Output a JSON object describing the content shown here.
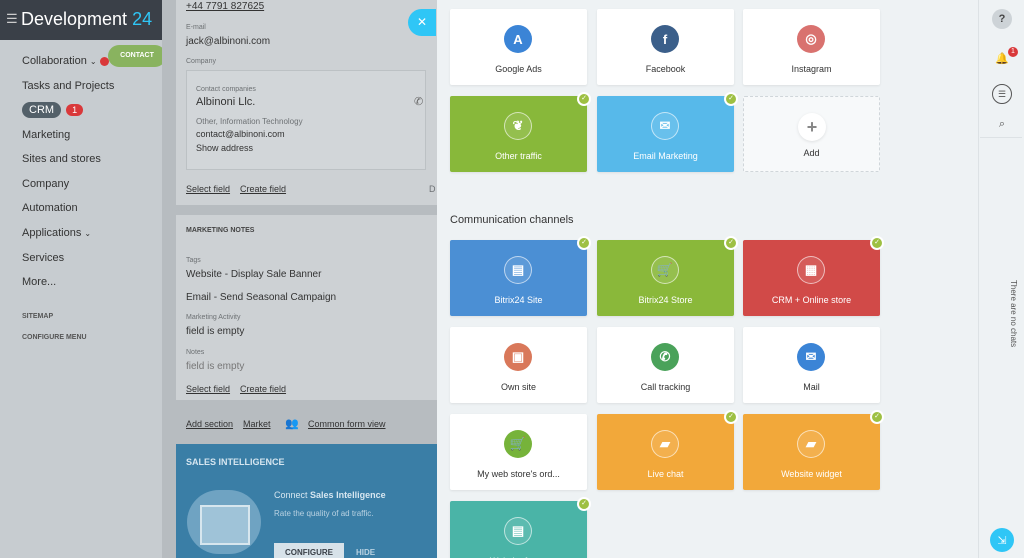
{
  "left_menu": {
    "title": "Development",
    "title_num": "24",
    "items": [
      "Collaboration",
      "Tasks and Projects",
      "CRM",
      "Marketing",
      "Sites and stores",
      "Company",
      "Automation",
      "Applications",
      "Services",
      "More..."
    ],
    "crm_badge": "1",
    "sitemap": "SITEMAP",
    "configure": "CONFIGURE MENU",
    "contact_button": "CONTACT"
  },
  "contact": {
    "phone": "+44 7791 827625",
    "email_label": "E-mail",
    "email": "jack@albinoni.com",
    "company_label": "Company",
    "contact_companies_label": "Contact companies",
    "company_name": "Albinoni Llc.",
    "company_info": "Other, Information Technology",
    "company_email": "contact@albinoni.com",
    "show_address": "Show address",
    "select_field": "Select field",
    "create_field": "Create field",
    "d": "D",
    "marketing_notes": "MARKETING NOTES",
    "tags_label": "Tags",
    "tag1": "Website - Display Sale Banner",
    "tag2": "Email - Send Seasonal Campaign",
    "activity_label": "Marketing Activity",
    "activity_value": "field is empty",
    "notes_label": "Notes",
    "notes_value": "field is empty",
    "add_section": "Add section",
    "market": "Market",
    "common_form": "Common form view"
  },
  "sales_intel": {
    "title": "SALES INTELLIGENCE",
    "connect": "Connect",
    "connect_bold": "Sales Intelligence",
    "rate": "Rate the quality of ad traffic.",
    "configure": "CONFIGURE",
    "hide": "HIDE"
  },
  "sources": [
    {
      "label": "Google Ads",
      "color": "#3b84d6",
      "icon": "google-ads-icon",
      "glyph": "A",
      "colored": false,
      "checked": false
    },
    {
      "label": "Facebook",
      "color": "#3b5f8a",
      "icon": "facebook-icon",
      "glyph": "f",
      "colored": false,
      "checked": false
    },
    {
      "label": "Instagram",
      "color": "#d9726f",
      "icon": "instagram-icon",
      "glyph": "◎",
      "colored": false,
      "checked": false
    },
    {
      "label": "Other traffic",
      "color": "#88b83a",
      "icon": "leaf-icon",
      "glyph": "❦",
      "colored": true,
      "checked": true
    },
    {
      "label": "Email Marketing",
      "color": "#57b9ea",
      "icon": "envelope-icon",
      "glyph": "✉",
      "colored": true,
      "checked": true
    },
    {
      "label": "Add",
      "color": "#ffffff",
      "icon": "plus-icon",
      "glyph": "+",
      "colored": false,
      "checked": false,
      "add": true
    }
  ],
  "channels_title": "Communication channels",
  "channels": [
    {
      "label": "Bitrix24 Site",
      "color": "#4b8fd4",
      "icon": "site-icon",
      "glyph": "▤",
      "colored": true,
      "checked": true
    },
    {
      "label": "Bitrix24 Store",
      "color": "#8ab83a",
      "icon": "cart-icon",
      "glyph": "🛒",
      "colored": true,
      "checked": true
    },
    {
      "label": "CRM + Online store",
      "color": "#d14a48",
      "icon": "crm-store-icon",
      "glyph": "▦",
      "colored": true,
      "checked": true
    },
    {
      "label": "Own site",
      "color": "#d9785a",
      "icon": "calendar-icon",
      "glyph": "▣",
      "colored": false,
      "checked": false
    },
    {
      "label": "Call tracking",
      "color": "#4aa25a",
      "icon": "phone-icon",
      "glyph": "✆",
      "colored": false,
      "checked": false
    },
    {
      "label": "Mail",
      "color": "#3b84d6",
      "icon": "mail-icon",
      "glyph": "✉",
      "colored": false,
      "checked": false
    },
    {
      "label": "My web store's ord...",
      "color": "#76b33a",
      "icon": "cart-icon",
      "glyph": "🛒",
      "colored": false,
      "checked": false
    },
    {
      "label": "Live chat",
      "color": "#f2a83a",
      "icon": "chat-icon",
      "glyph": "▰",
      "colored": true,
      "checked": true
    },
    {
      "label": "Website widget",
      "color": "#f2a83a",
      "icon": "widget-icon",
      "glyph": "▰",
      "colored": true,
      "checked": true
    },
    {
      "label": "Website forms",
      "color": "#4ab4a7",
      "icon": "form-icon",
      "glyph": "▤",
      "colored": true,
      "checked": true
    }
  ],
  "right_bar": {
    "no_chats": "There are no chats",
    "notif_badge": "1"
  }
}
